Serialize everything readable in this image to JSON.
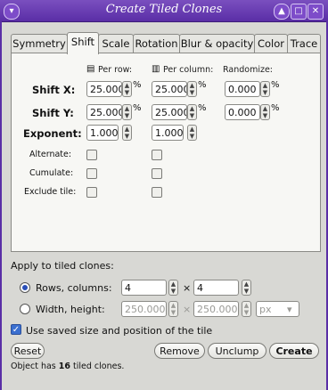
{
  "window": {
    "title": "Create Tiled Clones",
    "menu_icon": "chevron-down-icon",
    "controls": [
      "minimize-icon",
      "maximize-icon",
      "close-icon"
    ]
  },
  "tabs": [
    {
      "label": "Symmetry",
      "active": false
    },
    {
      "label": "Shift",
      "active": true
    },
    {
      "label": "Scale",
      "active": false
    },
    {
      "label": "Rotation",
      "active": false
    },
    {
      "label": "Blur & opacity",
      "active": false
    },
    {
      "label": "Color",
      "active": false
    },
    {
      "label": "Trace",
      "active": false
    }
  ],
  "shift": {
    "per_row_label": "Per row:",
    "per_column_label": "Per column:",
    "randomize_label": "Randomize:",
    "shift_x_label": "Shift X:",
    "shift_y_label": "Shift Y:",
    "exponent_label": "Exponent:",
    "alternate_label": "Alternate:",
    "cumulate_label": "Cumulate:",
    "exclude_tile_label": "Exclude tile:",
    "shift_x": {
      "row": "25.000",
      "col": "25.000",
      "rand": "0.000"
    },
    "shift_y": {
      "row": "25.000",
      "col": "25.000",
      "rand": "0.000"
    },
    "exponent": {
      "row": "1.000",
      "col": "1.000"
    },
    "percent": "%"
  },
  "bottom": {
    "apply_label": "Apply to tiled clones:",
    "rows_columns_label": "Rows, columns:",
    "rows_value": "4",
    "cols_value": "4",
    "times": "×",
    "width_height_label": "Width, height:",
    "width_value": "250.0000",
    "height_value": "250.0000",
    "unit": "px",
    "use_saved_label": "Use saved size and position of the tile",
    "reset_label": "Reset",
    "remove_label": "Remove",
    "unclump_label": "Unclump",
    "create_label": "Create",
    "status_prefix": "Object has ",
    "status_count": "16",
    "status_suffix": " tiled clones."
  }
}
